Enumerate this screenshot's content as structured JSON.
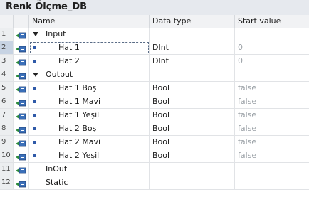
{
  "title": "Renk Ölçme_DB",
  "columns": {
    "name": "Name",
    "type": "Data type",
    "start": "Start value"
  },
  "rows": [
    {
      "idx": "1",
      "name": "Input",
      "type": "",
      "start": "",
      "level": 0,
      "expand": true,
      "bullet": false
    },
    {
      "idx": "2",
      "name": "Hat 1",
      "type": "DInt",
      "start": "0",
      "level": 1,
      "expand": false,
      "bullet": true,
      "selected": true
    },
    {
      "idx": "3",
      "name": "Hat 2",
      "type": "DInt",
      "start": "0",
      "level": 1,
      "expand": false,
      "bullet": true
    },
    {
      "idx": "4",
      "name": "Output",
      "type": "",
      "start": "",
      "level": 0,
      "expand": true,
      "bullet": false
    },
    {
      "idx": "5",
      "name": "Hat 1 Boş",
      "type": "Bool",
      "start": "false",
      "level": 1,
      "expand": false,
      "bullet": true
    },
    {
      "idx": "6",
      "name": "Hat 1 Mavi",
      "type": "Bool",
      "start": "false",
      "level": 1,
      "expand": false,
      "bullet": true
    },
    {
      "idx": "7",
      "name": "Hat 1 Yeşil",
      "type": "Bool",
      "start": "false",
      "level": 1,
      "expand": false,
      "bullet": true
    },
    {
      "idx": "8",
      "name": "Hat 2 Boş",
      "type": "Bool",
      "start": "false",
      "level": 1,
      "expand": false,
      "bullet": true
    },
    {
      "idx": "9",
      "name": "Hat 2 Mavi",
      "type": "Bool",
      "start": "false",
      "level": 1,
      "expand": false,
      "bullet": true
    },
    {
      "idx": "10",
      "name": "Hat 2 Yeşil",
      "type": "Bool",
      "start": "false",
      "level": 1,
      "expand": false,
      "bullet": true
    },
    {
      "idx": "11",
      "name": "InOut",
      "type": "",
      "start": "",
      "level": 0,
      "expand": false,
      "bullet": false
    },
    {
      "idx": "12",
      "name": "Static",
      "type": "",
      "start": "",
      "level": 0,
      "expand": false,
      "bullet": false
    }
  ],
  "colors": {
    "accent": "#2f5aa8",
    "header_bg": "#f1f2f4",
    "title_bg": "#e6e9ee"
  },
  "icons": {
    "db_interface": "db-interface-icon",
    "expand": "expand-triangle-icon",
    "bullet": "member-bullet-icon"
  }
}
